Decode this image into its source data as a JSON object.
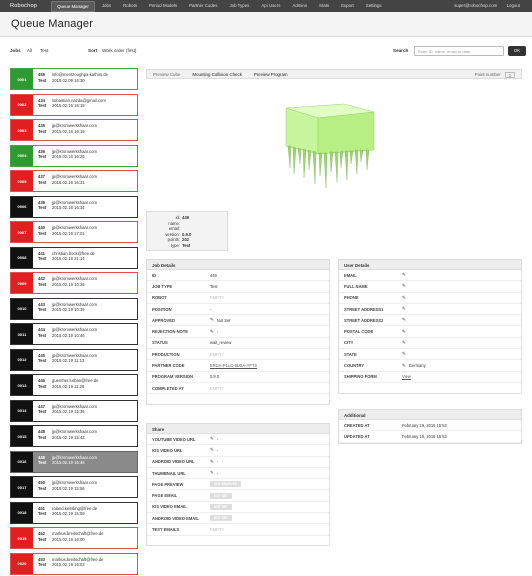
{
  "nav": {
    "brand": "Robochop",
    "items": [
      "Queue Manager",
      "Jobs",
      "Robots",
      "Period Models",
      "Partner Codes",
      "Job Types",
      "Api Users",
      "Admins",
      "Stats",
      "Export",
      "Settings"
    ],
    "user_email": "super@robochop.com",
    "logout": "Logout"
  },
  "page": {
    "title": "Queue Manager"
  },
  "filters": {
    "jobs_label": "Jobs",
    "jobs_value_1": "All",
    "jobs_value_2": "Test",
    "sort_label": "Sort",
    "sort_value": "Work order (first)",
    "search_label": "Search",
    "search_placeholder": "Enter ID, name, email or date",
    "ok_label": "OK"
  },
  "jobs": [
    {
      "badge": "0001",
      "color": "green",
      "id": "455",
      "email": "info@mentzoughpa-kathos.de",
      "type": "Test",
      "date": "2015.02.09 16:30"
    },
    {
      "badge": "0002",
      "color": "red",
      "id": "434",
      "email": "sebastian.nazda@gmail.com",
      "type": "Test",
      "date": "2015.02.16 16:19"
    },
    {
      "badge": "0003",
      "color": "red",
      "id": "435",
      "email": "jp@kromwerkshaar.com",
      "type": "Test",
      "date": "2015.02.16 16:19"
    },
    {
      "badge": "0004",
      "color": "green",
      "id": "436",
      "email": "jp@kromwerkshaar.com",
      "type": "Test",
      "date": "2015.02.16 16:26"
    },
    {
      "badge": "0005",
      "color": "red",
      "id": "437",
      "email": "jp@kromwerkshaar.com",
      "type": "Test",
      "date": "2015.02.16 16:31"
    },
    {
      "badge": "0006",
      "color": "black",
      "id": "438",
      "email": "jp@kromwerkshaar.com",
      "type": "Test",
      "date": "2015.02.16 16:34"
    },
    {
      "badge": "0007",
      "color": "red",
      "id": "440",
      "email": "jp@kromwerkshaar.com",
      "type": "Test",
      "date": "2015.02.16 17:01"
    },
    {
      "badge": "0008",
      "color": "black",
      "id": "441",
      "email": "christian.bock@free.de",
      "type": "Test",
      "date": "2015.02.18 21:14"
    },
    {
      "badge": "0009",
      "color": "red",
      "id": "442",
      "email": "jp@kromwerkshaar.com",
      "type": "Test",
      "date": "2015.02.19 10:26"
    },
    {
      "badge": "0010",
      "color": "black",
      "id": "443",
      "email": "jp@kromwerkshaar.com",
      "type": "Test",
      "date": "2015.02.19 10:39"
    },
    {
      "badge": "0011",
      "color": "black",
      "id": "444",
      "email": "jp@kromwerkshaar.com",
      "type": "Test",
      "date": "2015.02.19 10:46"
    },
    {
      "badge": "0012",
      "color": "black",
      "id": "445",
      "email": "jp@kromwerkshaar.com",
      "type": "Test",
      "date": "2015.02.19 11:13"
    },
    {
      "badge": "0013",
      "color": "black",
      "id": "446",
      "email": "guenther.lurban@free.de",
      "type": "Test",
      "date": "2015.02.19 11:26"
    },
    {
      "badge": "0014",
      "color": "black",
      "id": "447",
      "email": "jp@kromwerkshaar.com",
      "type": "Test",
      "date": "2015.02.19 15:36"
    },
    {
      "badge": "0015",
      "color": "black",
      "id": "448",
      "email": "jp@kromwerkshaar.com",
      "type": "Test",
      "date": "2015.02.19 15:43"
    },
    {
      "badge": "0016",
      "color": "selected",
      "id": "449",
      "email": "jp@kromwerkshaar.com",
      "type": "Test",
      "date": "2015.02.19 15:48"
    },
    {
      "badge": "0017",
      "color": "black",
      "id": "450",
      "email": "jp@kromwerkshaar.com",
      "type": "Test",
      "date": "2015.02.19 15:56"
    },
    {
      "badge": "0018",
      "color": "black",
      "id": "451",
      "email": "roland.kessling@free.de",
      "type": "Test",
      "date": "2015.02.19 15:59"
    },
    {
      "badge": "0019",
      "color": "red",
      "id": "452",
      "email": "markus.breitschaft@free.de",
      "type": "Test",
      "date": "2015.02.19 16:00"
    },
    {
      "badge": "0020",
      "color": "red",
      "id": "453",
      "email": "markus.breitschaft@free.de",
      "type": "Test",
      "date": "2015.02.19 16:03"
    }
  ],
  "preview": {
    "tabs": [
      "Preview Cube",
      "Mounting Collision Check",
      "Preview Program"
    ],
    "point_number_label": "Point number",
    "point_number_value": "1"
  },
  "meta": [
    {
      "k": "id:",
      "v": "449"
    },
    {
      "k": "name:",
      "v": ""
    },
    {
      "k": "email:",
      "v": ""
    },
    {
      "k": "version:",
      "v": "0.9.0"
    },
    {
      "k": "points:",
      "v": "202"
    },
    {
      "k": "type:",
      "v": "Test"
    }
  ],
  "job_details": {
    "title": "Job Details",
    "rows": [
      {
        "k": "ID",
        "v": "449",
        "pen": false,
        "style": ""
      },
      {
        "k": "JOB TYPE",
        "v": "Test",
        "pen": false,
        "style": ""
      },
      {
        "k": "ROBOT",
        "v": "EMPTY",
        "pen": false,
        "style": "dim"
      },
      {
        "k": "POSITION",
        "v": "-",
        "pen": false,
        "style": ""
      },
      {
        "k": "APPROVED",
        "v": "Not Set",
        "pen": true,
        "style": ""
      },
      {
        "k": "REJECTION NOTE",
        "v": "-",
        "pen": true,
        "style": ""
      },
      {
        "k": "STATUS",
        "v": "wait_review",
        "pen": false,
        "style": ""
      },
      {
        "k": "PRODUCTION",
        "v": "EMPTY",
        "pen": false,
        "style": "dim"
      },
      {
        "k": "PARTNER CODE",
        "v": "ERUA-P1LG-9USA-YFTS",
        "pen": false,
        "style": "link"
      },
      {
        "k": "PROGRAM VERSION",
        "v": "0.9.0",
        "pen": false,
        "style": ""
      },
      {
        "k": "COMPLETED AT",
        "v": "EMPTY",
        "pen": false,
        "style": "dim"
      }
    ]
  },
  "user_details": {
    "title": "User Details",
    "rows": [
      {
        "k": "EMAIL",
        "v": "",
        "pen": true,
        "style": ""
      },
      {
        "k": "FULL NAME",
        "v": "",
        "pen": true,
        "style": ""
      },
      {
        "k": "PHONE",
        "v": "",
        "pen": true,
        "style": ""
      },
      {
        "k": "STREET ADDRESS1",
        "v": "",
        "pen": true,
        "style": ""
      },
      {
        "k": "STREET ADDRESS2",
        "v": "",
        "pen": true,
        "style": ""
      },
      {
        "k": "POSTAL CODE",
        "v": "",
        "pen": true,
        "style": ""
      },
      {
        "k": "CITY",
        "v": "",
        "pen": true,
        "style": ""
      },
      {
        "k": "STATE",
        "v": "",
        "pen": true,
        "style": ""
      },
      {
        "k": "COUNTRY",
        "v": "Germany",
        "pen": true,
        "style": ""
      },
      {
        "k": "SHIPPING FORM",
        "v": "View",
        "pen": false,
        "style": "link"
      }
    ]
  },
  "additional": {
    "title": "Additional",
    "rows": [
      {
        "k": "CREATED AT",
        "v": "February 19, 2015 15:53",
        "pen": false,
        "style": ""
      },
      {
        "k": "UPDATED AT",
        "v": "February 19, 2015 15:53",
        "pen": false,
        "style": ""
      }
    ]
  },
  "share": {
    "title": "Share",
    "rows": [
      {
        "k": "YOUTUBE VIDEO URL",
        "v": "-",
        "pen": true,
        "style": ""
      },
      {
        "k": "IOS VIDEO URL",
        "v": "-",
        "pen": true,
        "style": ""
      },
      {
        "k": "ANDROID VIDEO URL",
        "v": "-",
        "pen": true,
        "style": ""
      },
      {
        "k": "THUMBNAIL URL",
        "v": "-",
        "pen": true,
        "style": ""
      },
      {
        "k": "PAGE PREVIEW",
        "v": "NOT ENABLED",
        "pen": false,
        "style": "btn"
      },
      {
        "k": "PAGE EMAIL",
        "v": "NOT SET",
        "pen": false,
        "style": "btn"
      },
      {
        "k": "IOS VIDEO EMAIL",
        "v": "NOT SET",
        "pen": false,
        "style": "btn"
      },
      {
        "k": "ANDROID VIDEO EMAIL",
        "v": "NOT SET",
        "pen": false,
        "style": "btn"
      },
      {
        "k": "TEST EMAILS",
        "v": "EMPTY",
        "pen": false,
        "style": "dim"
      }
    ]
  },
  "colors": {
    "accent_green": "#c8ff9a",
    "badge_red": "#e02020",
    "badge_green": "#2f9a2f",
    "badge_black": "#111111"
  }
}
